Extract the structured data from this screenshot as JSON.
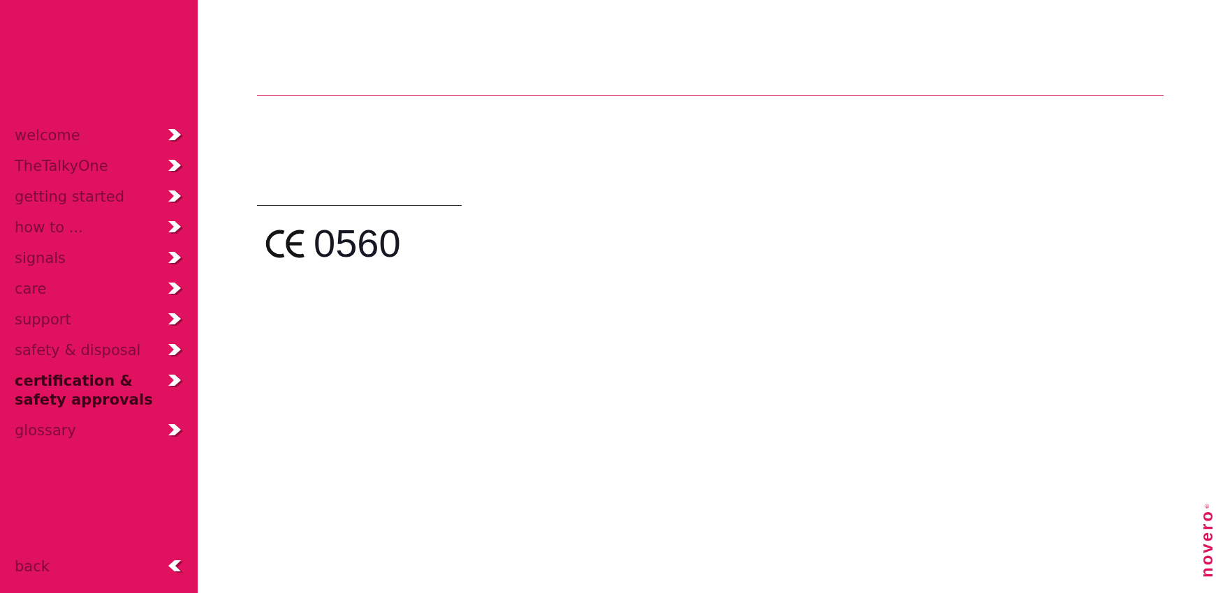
{
  "sidebar": {
    "items": [
      {
        "label": "welcome",
        "selected": false
      },
      {
        "label": "TheTalkyOne",
        "selected": false
      },
      {
        "label": "getting started",
        "selected": false
      },
      {
        "label": "how to ...",
        "selected": false
      },
      {
        "label": "signals",
        "selected": false
      },
      {
        "label": "care",
        "selected": false
      },
      {
        "label": "support",
        "selected": false
      },
      {
        "label": "safety & disposal",
        "selected": false
      },
      {
        "label": "certification & safety approvals",
        "selected": true
      },
      {
        "label": "glossary",
        "selected": false
      }
    ],
    "back": {
      "label": "back"
    }
  },
  "certification": {
    "number": "0560"
  },
  "logo": {
    "text": "novero",
    "mark": "®"
  }
}
